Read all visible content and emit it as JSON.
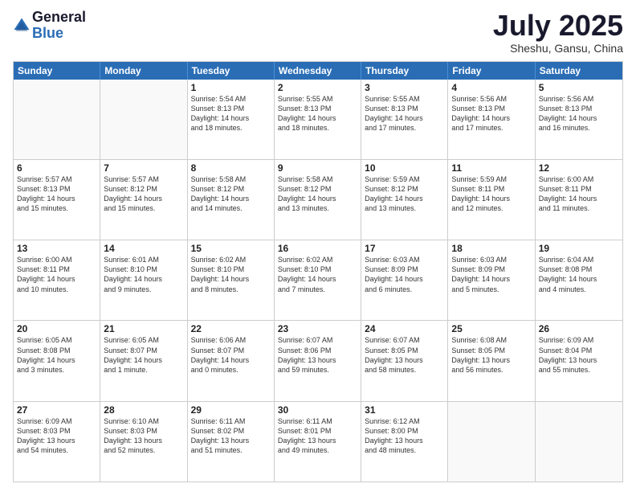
{
  "logo": {
    "general": "General",
    "blue": "Blue"
  },
  "title": "July 2025",
  "location": "Sheshu, Gansu, China",
  "header_days": [
    "Sunday",
    "Monday",
    "Tuesday",
    "Wednesday",
    "Thursday",
    "Friday",
    "Saturday"
  ],
  "weeks": [
    [
      {
        "day": "",
        "info": ""
      },
      {
        "day": "",
        "info": ""
      },
      {
        "day": "1",
        "info": "Sunrise: 5:54 AM\nSunset: 8:13 PM\nDaylight: 14 hours\nand 18 minutes."
      },
      {
        "day": "2",
        "info": "Sunrise: 5:55 AM\nSunset: 8:13 PM\nDaylight: 14 hours\nand 18 minutes."
      },
      {
        "day": "3",
        "info": "Sunrise: 5:55 AM\nSunset: 8:13 PM\nDaylight: 14 hours\nand 17 minutes."
      },
      {
        "day": "4",
        "info": "Sunrise: 5:56 AM\nSunset: 8:13 PM\nDaylight: 14 hours\nand 17 minutes."
      },
      {
        "day": "5",
        "info": "Sunrise: 5:56 AM\nSunset: 8:13 PM\nDaylight: 14 hours\nand 16 minutes."
      }
    ],
    [
      {
        "day": "6",
        "info": "Sunrise: 5:57 AM\nSunset: 8:13 PM\nDaylight: 14 hours\nand 15 minutes."
      },
      {
        "day": "7",
        "info": "Sunrise: 5:57 AM\nSunset: 8:12 PM\nDaylight: 14 hours\nand 15 minutes."
      },
      {
        "day": "8",
        "info": "Sunrise: 5:58 AM\nSunset: 8:12 PM\nDaylight: 14 hours\nand 14 minutes."
      },
      {
        "day": "9",
        "info": "Sunrise: 5:58 AM\nSunset: 8:12 PM\nDaylight: 14 hours\nand 13 minutes."
      },
      {
        "day": "10",
        "info": "Sunrise: 5:59 AM\nSunset: 8:12 PM\nDaylight: 14 hours\nand 13 minutes."
      },
      {
        "day": "11",
        "info": "Sunrise: 5:59 AM\nSunset: 8:11 PM\nDaylight: 14 hours\nand 12 minutes."
      },
      {
        "day": "12",
        "info": "Sunrise: 6:00 AM\nSunset: 8:11 PM\nDaylight: 14 hours\nand 11 minutes."
      }
    ],
    [
      {
        "day": "13",
        "info": "Sunrise: 6:00 AM\nSunset: 8:11 PM\nDaylight: 14 hours\nand 10 minutes."
      },
      {
        "day": "14",
        "info": "Sunrise: 6:01 AM\nSunset: 8:10 PM\nDaylight: 14 hours\nand 9 minutes."
      },
      {
        "day": "15",
        "info": "Sunrise: 6:02 AM\nSunset: 8:10 PM\nDaylight: 14 hours\nand 8 minutes."
      },
      {
        "day": "16",
        "info": "Sunrise: 6:02 AM\nSunset: 8:10 PM\nDaylight: 14 hours\nand 7 minutes."
      },
      {
        "day": "17",
        "info": "Sunrise: 6:03 AM\nSunset: 8:09 PM\nDaylight: 14 hours\nand 6 minutes."
      },
      {
        "day": "18",
        "info": "Sunrise: 6:03 AM\nSunset: 8:09 PM\nDaylight: 14 hours\nand 5 minutes."
      },
      {
        "day": "19",
        "info": "Sunrise: 6:04 AM\nSunset: 8:08 PM\nDaylight: 14 hours\nand 4 minutes."
      }
    ],
    [
      {
        "day": "20",
        "info": "Sunrise: 6:05 AM\nSunset: 8:08 PM\nDaylight: 14 hours\nand 3 minutes."
      },
      {
        "day": "21",
        "info": "Sunrise: 6:05 AM\nSunset: 8:07 PM\nDaylight: 14 hours\nand 1 minute."
      },
      {
        "day": "22",
        "info": "Sunrise: 6:06 AM\nSunset: 8:07 PM\nDaylight: 14 hours\nand 0 minutes."
      },
      {
        "day": "23",
        "info": "Sunrise: 6:07 AM\nSunset: 8:06 PM\nDaylight: 13 hours\nand 59 minutes."
      },
      {
        "day": "24",
        "info": "Sunrise: 6:07 AM\nSunset: 8:05 PM\nDaylight: 13 hours\nand 58 minutes."
      },
      {
        "day": "25",
        "info": "Sunrise: 6:08 AM\nSunset: 8:05 PM\nDaylight: 13 hours\nand 56 minutes."
      },
      {
        "day": "26",
        "info": "Sunrise: 6:09 AM\nSunset: 8:04 PM\nDaylight: 13 hours\nand 55 minutes."
      }
    ],
    [
      {
        "day": "27",
        "info": "Sunrise: 6:09 AM\nSunset: 8:03 PM\nDaylight: 13 hours\nand 54 minutes."
      },
      {
        "day": "28",
        "info": "Sunrise: 6:10 AM\nSunset: 8:03 PM\nDaylight: 13 hours\nand 52 minutes."
      },
      {
        "day": "29",
        "info": "Sunrise: 6:11 AM\nSunset: 8:02 PM\nDaylight: 13 hours\nand 51 minutes."
      },
      {
        "day": "30",
        "info": "Sunrise: 6:11 AM\nSunset: 8:01 PM\nDaylight: 13 hours\nand 49 minutes."
      },
      {
        "day": "31",
        "info": "Sunrise: 6:12 AM\nSunset: 8:00 PM\nDaylight: 13 hours\nand 48 minutes."
      },
      {
        "day": "",
        "info": ""
      },
      {
        "day": "",
        "info": ""
      }
    ]
  ]
}
